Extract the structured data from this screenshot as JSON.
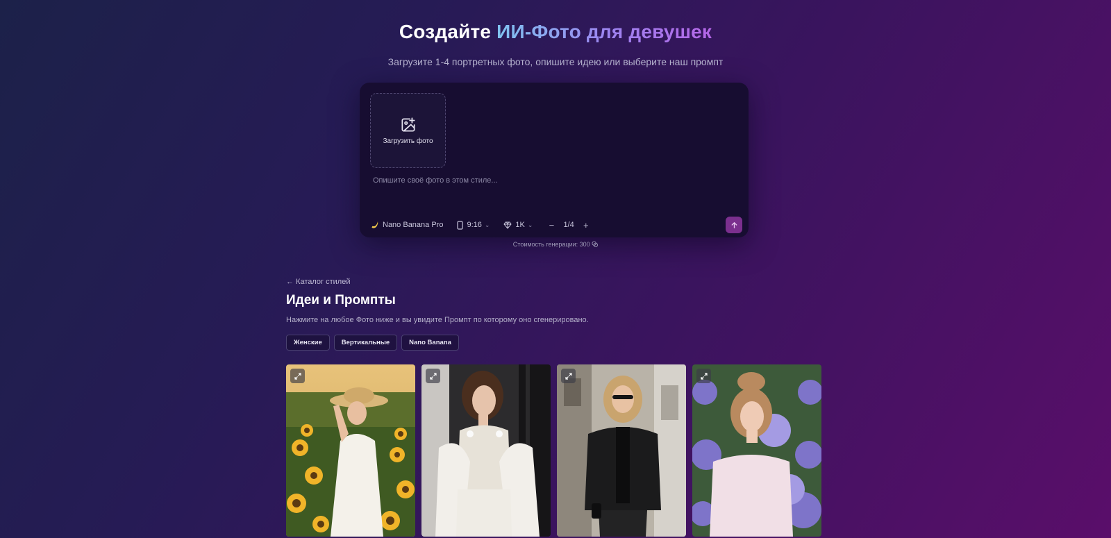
{
  "hero": {
    "title_plain": "Создайте ",
    "title_accent": "ИИ-Фото для девушек",
    "subtitle": "Загрузите 1-4 портретных фото, опишите идею или выберите наш промпт"
  },
  "composer": {
    "upload_label": "Загрузить фото",
    "prompt_placeholder": "Опишите своё фото в этом стиле...",
    "model_label": "Nano Banana Pro",
    "model_icon": "banana-icon",
    "aspect_label": "9:16",
    "aspect_icon": "phone-icon",
    "quality_label": "1K",
    "quality_icon": "diamond-icon",
    "count_value": "1/4",
    "count_minus": "−",
    "count_plus": "+",
    "send_icon": "arrow-up-icon"
  },
  "cost_text": "Стоимость генерации: 300",
  "catalog": {
    "back_link": "← Каталог стилей",
    "title": "Идеи и Промпты",
    "description": "Нажмите на любое Фото ниже и вы увидите Промпт по которому оно сгенерировано.",
    "chips": [
      "Женские",
      "Вертикальные",
      "Nano Banana"
    ]
  },
  "gallery": [
    {
      "name": "sunflower-field-woman-photo",
      "scene": "woman in straw hat and white dress in a sunflower field"
    },
    {
      "name": "white-corset-woman-photo",
      "scene": "woman in white corset and feather wrap by a window"
    },
    {
      "name": "leather-jacket-woman-photo",
      "scene": "woman in black leather jacket and sunglasses on a city street"
    },
    {
      "name": "hydrangea-woman-photo",
      "scene": "woman with updo holding purple hydrangeas"
    }
  ],
  "colors": {
    "accent_gradient_start": "#7fc4f0",
    "accent_gradient_end": "#b566e8",
    "send_button": "#7b2f8e",
    "composer_bg": "#170d31"
  }
}
